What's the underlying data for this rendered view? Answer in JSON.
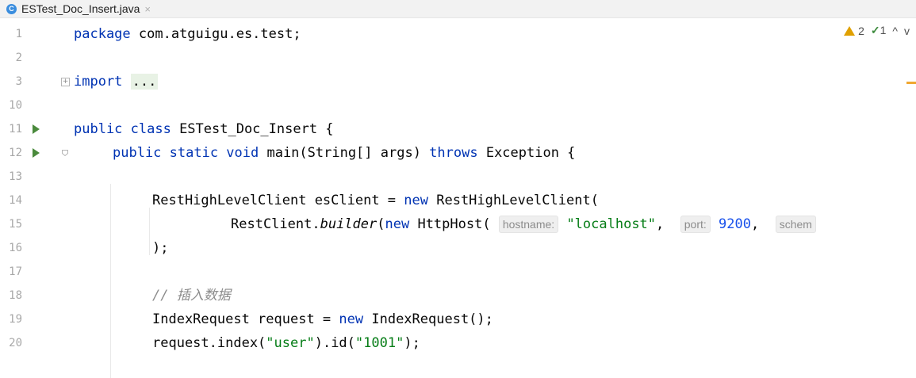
{
  "tab": {
    "icon": "C",
    "title": "ESTest_Doc_Insert.java",
    "close": "×"
  },
  "inspection": {
    "warnings": "2",
    "weak_warnings": "1",
    "up": "^",
    "down": "v"
  },
  "line_numbers": [
    "1",
    "2",
    "3",
    "10",
    "11",
    "12",
    "13",
    "14",
    "15",
    "16",
    "17",
    "18",
    "19",
    "20"
  ],
  "code": {
    "l1_kw": "package",
    "l1_rest": " com.atguigu.es.test;",
    "l3_kw": "import",
    "l3_fold": "...",
    "l11_kw": "public class",
    "l11_rest": " ESTest_Doc_Insert {",
    "l12_kw1": "public static void",
    "l12_mid": " main(String[] args) ",
    "l12_kw2": "throws",
    "l12_rest": " Exception {",
    "l14_a": "RestHighLevelClient esClient = ",
    "l14_kw": "new",
    "l14_b": " RestHighLevelClient(",
    "l15_a": "RestClient.",
    "l15_it": "builder",
    "l15_b": "(",
    "l15_kw": "new",
    "l15_c": " HttpHost( ",
    "l15_hint1": "hostname:",
    "l15_str": "\"localhost\"",
    "l15_d": ", ",
    "l15_hint2": "port:",
    "l15_num": "9200",
    "l15_e": ", ",
    "l15_hint3": "schem",
    "l16": ");",
    "l18_cmt": "// 插入数据",
    "l19_a": "IndexRequest request = ",
    "l19_kw": "new",
    "l19_b": " IndexRequest();",
    "l20_a": "request.index(",
    "l20_s1": "\"user\"",
    "l20_b": ").id(",
    "l20_s2": "\"1001\"",
    "l20_c": ");"
  }
}
